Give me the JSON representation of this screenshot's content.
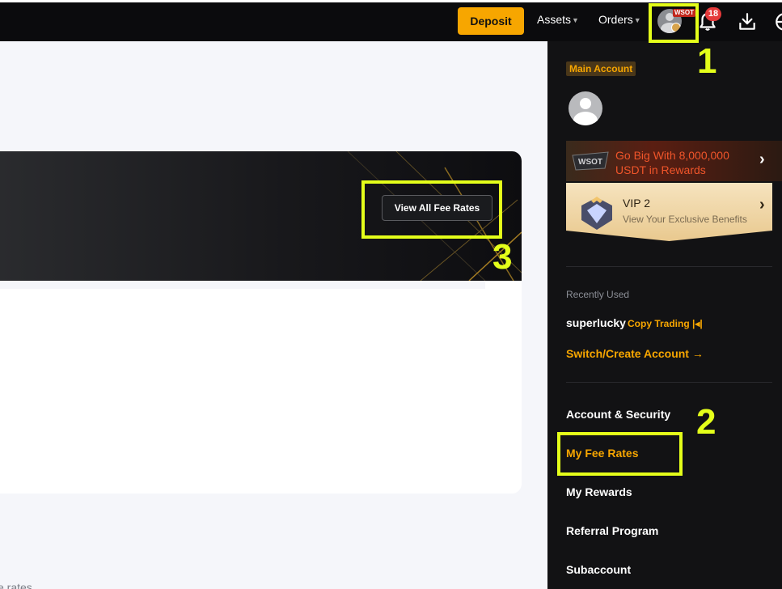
{
  "header": {
    "deposit_label": "Deposit",
    "assets_label": "Assets",
    "orders_label": "Orders",
    "avatar_badge": "WSOT",
    "notification_count": "18"
  },
  "main": {
    "fee_button_label": "View All Fee Rates",
    "bottom_text": "e rates"
  },
  "dropdown": {
    "account_type": "Main Account",
    "promo_text": "Go Big With 8,000,000 USDT in Rewards",
    "promo_logo_text": "WSOT",
    "vip_title": "VIP 2",
    "vip_subtitle": "View Your Exclusive Benefits",
    "recently_used_label": "Recently Used",
    "recent_account_name": "superlucky",
    "recent_account_tag": "Copy Trading",
    "switch_label": "Switch/Create Account",
    "menu_items": [
      "Account & Security",
      "My Fee Rates",
      "My Rewards",
      "Referral Program",
      "Subaccount"
    ]
  },
  "annotations": [
    "1",
    "2",
    "3"
  ],
  "colors": {
    "accent": "#f7a600",
    "highlight": "#e4ff1a",
    "notification": "#e5393a",
    "dark_bg": "#121214"
  }
}
